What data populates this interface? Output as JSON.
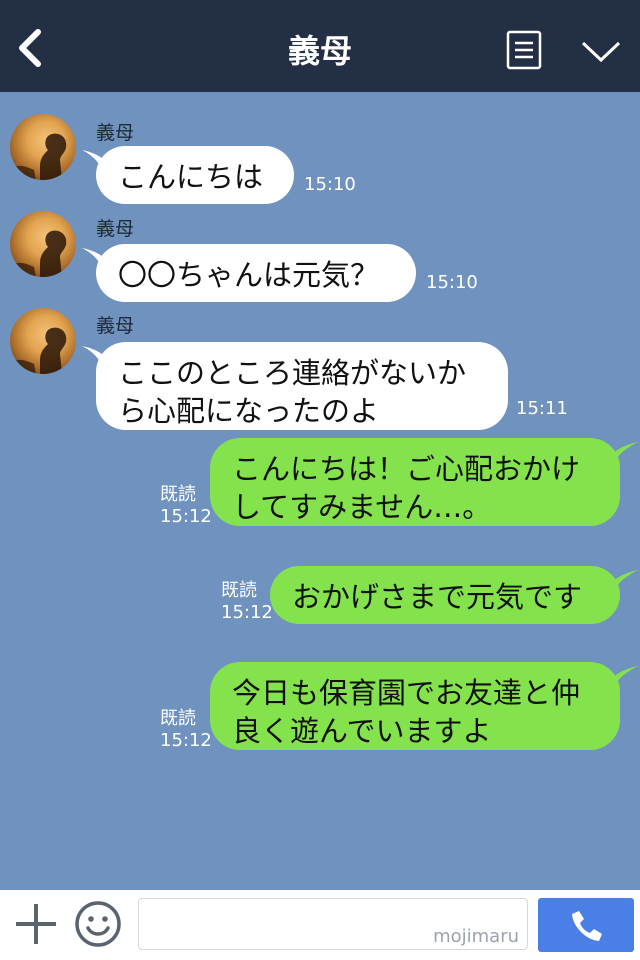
{
  "header": {
    "title": "義母"
  },
  "messages": [
    {
      "sender": "義母",
      "text": "こんにちは",
      "time": "15:10"
    },
    {
      "sender": "義母",
      "text": "〇〇ちゃんは元気？",
      "time": "15:10"
    },
    {
      "sender": "義母",
      "text": "ここのところ連絡がないか\nら心配になったのよ",
      "time": "15:11"
    },
    {
      "text": "こんにちは！ご心配おかけ\nしてすみません…。",
      "read": "既読",
      "time": "15:12"
    },
    {
      "text": "おかげさまで元気です",
      "read": "既読",
      "time": "15:12"
    },
    {
      "text": "今日も保育園でお友達と仲\n良く遊んでいますよ",
      "read": "既読",
      "time": "15:12"
    }
  ],
  "footer": {
    "watermark": "mojimaru"
  },
  "colors": {
    "header": "#232f45",
    "background": "#7092bf",
    "outgoing_bubble": "#84e24c",
    "incoming_bubble": "#ffffff",
    "call_button": "#4a7fe6"
  },
  "icons": [
    "back-icon",
    "menu-icon",
    "chevron-down-icon",
    "plus-icon",
    "emoji-icon",
    "phone-icon"
  ]
}
